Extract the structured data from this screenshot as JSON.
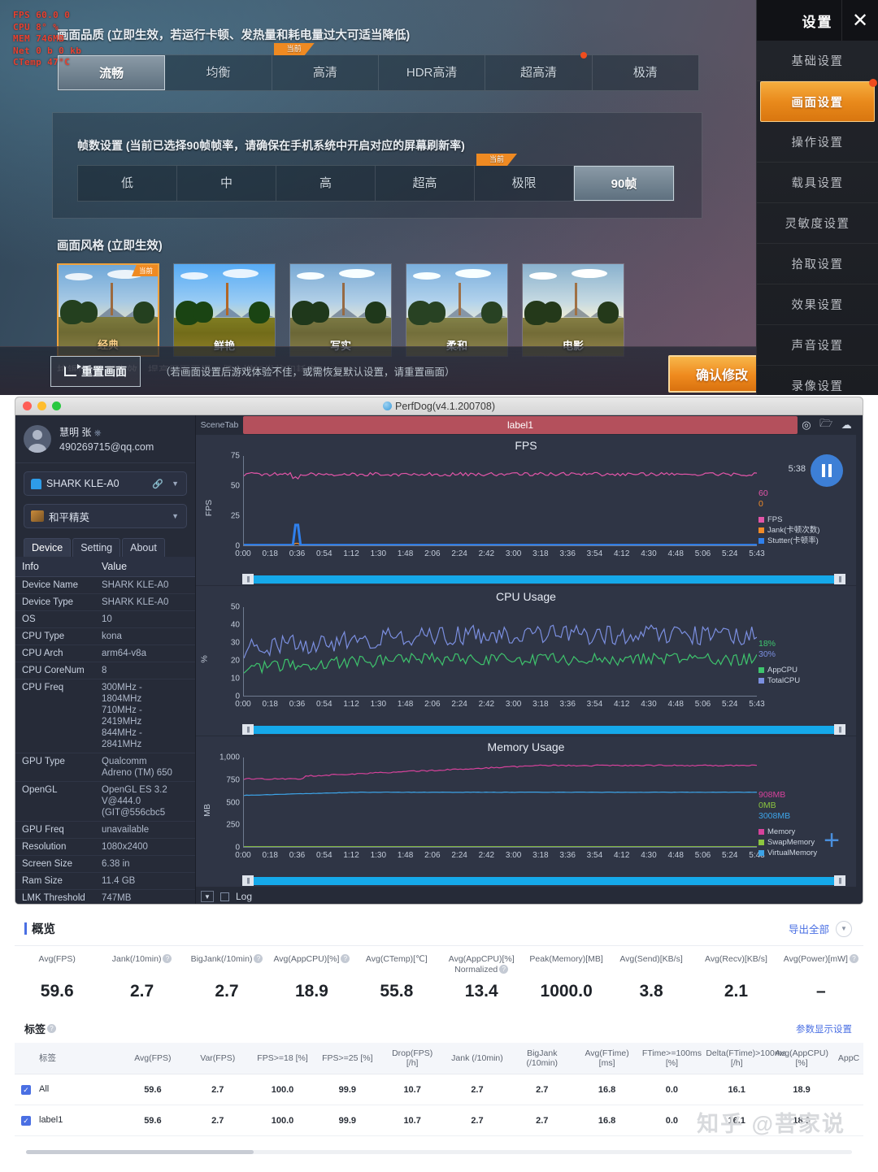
{
  "game": {
    "hud": [
      "FPS  60.0  0",
      "CPU  8°   %",
      "MEM  746MB",
      "Net  0 b   0 kb",
      "CTemp 47°C"
    ],
    "quality_title": "画面品质 (立即生效，若运行卡顿、发热量和耗电量过大可适当降低)",
    "quality_options": [
      "流畅",
      "均衡",
      "高清",
      "HDR高清",
      "超高清",
      "极清"
    ],
    "quality_selected_index": 0,
    "quality_current_index": 2,
    "fps_title": "帧数设置 (当前已选择90帧帧率，请确保在手机系统中开启对应的屏幕刷新率)",
    "fps_options": [
      "低",
      "中",
      "高",
      "超高",
      "极限",
      "90帧"
    ],
    "fps_selected_index": 5,
    "fps_current_index": 4,
    "style_title": "画面风格 (立即生效)",
    "styles": [
      "经典",
      "鲜艳",
      "写实",
      "柔和",
      "电影"
    ],
    "style_selected_index": 0,
    "current_badge": "当前",
    "cut_text": "抗锯齿 (立即生效，提高画面平滑，但会增加发热和耗电)",
    "reset_label": "重置画面",
    "footer_note": "（若画面设置后游戏体验不佳，或需恢复默认设置，请重置画面）",
    "confirm_label": "确认修改",
    "sidebar": {
      "title": "设置",
      "close_icon": "close-icon",
      "items": [
        "基础设置",
        "画面设置",
        "操作设置",
        "载具设置",
        "灵敏度设置",
        "拾取设置",
        "效果设置",
        "声音设置",
        "录像设置"
      ],
      "active_index": 1
    }
  },
  "perfdog": {
    "window_title": "PerfDog(v4.1.200708)",
    "user": {
      "name": "慧明 张",
      "power_icon": "power-icon",
      "email": "490269715@qq.com"
    },
    "device_select": {
      "value": "SHARK KLE-A0",
      "icon": "android-icon",
      "link_icon": "link-icon",
      "caret": "▼"
    },
    "app_select": {
      "value": "和平精英",
      "icon": "game-icon",
      "caret": "▼"
    },
    "tabs": [
      "Device",
      "Setting",
      "About"
    ],
    "active_tab": 0,
    "info_headers": [
      "Info",
      "Value"
    ],
    "info_rows": [
      [
        "Device Name",
        "SHARK KLE-A0"
      ],
      [
        "Device Type",
        "SHARK KLE-A0"
      ],
      [
        "OS",
        "10"
      ],
      [
        "CPU Type",
        "kona"
      ],
      [
        "CPU Arch",
        "arm64-v8a"
      ],
      [
        "CPU CoreNum",
        "8"
      ],
      [
        "CPU Freq",
        "300MHz -\n1804MHz\n710MHz -\n2419MHz\n844MHz -\n2841MHz"
      ],
      [
        "GPU Type",
        "Qualcomm\nAdreno (TM) 650"
      ],
      [
        "OpenGL",
        "OpenGL ES 3.2\nV@444.0\n(GIT@556cbc5"
      ],
      [
        "GPU Freq",
        "unavailable"
      ],
      [
        "Resolution",
        "1080x2400"
      ],
      [
        "Screen Size",
        "6.38 in"
      ],
      [
        "Ram Size",
        "11.4 GB"
      ],
      [
        "LMK Threshold",
        "747MB"
      ]
    ],
    "scene_tab_label": "SceneTab",
    "label_bar": "label1",
    "scene_icons": [
      "location-icon",
      "folder-icon",
      "cloud-icon"
    ],
    "elapsed_time": "5:38",
    "pause_icon": "pause-icon",
    "plus_icon": "plus-icon",
    "log_label": "Log",
    "log_checked": false
  },
  "chart_data": [
    {
      "type": "line",
      "title": "FPS",
      "ylabel": "FPS",
      "ylim": [
        0,
        75
      ],
      "yticks": [
        0,
        25,
        50,
        75
      ],
      "xlabel": "",
      "xticks": [
        "0:00",
        "0:18",
        "0:36",
        "0:54",
        "1:12",
        "1:30",
        "1:48",
        "2:06",
        "2:24",
        "2:42",
        "3:00",
        "3:18",
        "3:36",
        "3:54",
        "4:12",
        "4:30",
        "4:48",
        "5:06",
        "5:24",
        "5:43"
      ],
      "current_values": [
        {
          "label": "60",
          "color": "#e255a8"
        },
        {
          "label": "0",
          "color": "#f08b28"
        }
      ],
      "legend": [
        {
          "name": "FPS",
          "color": "#e255a8"
        },
        {
          "name": "Jank(卡顿次数)",
          "color": "#f08b28"
        },
        {
          "name": "Stutter(卡顿率)",
          "color": "#2f80ed"
        }
      ],
      "series": [
        {
          "name": "FPS",
          "color": "#e255a8",
          "approx_mean": 59.6,
          "min": 51,
          "max": 62
        },
        {
          "name": "Jank(卡顿次数)",
          "color": "#f08b28",
          "approx_mean": 0,
          "min": 0,
          "max": 5
        },
        {
          "name": "Stutter(卡顿率)",
          "color": "#2f80ed",
          "approx_mean": 0,
          "min": 0,
          "max": 17
        }
      ]
    },
    {
      "type": "line",
      "title": "CPU Usage",
      "ylabel": "%",
      "ylim": [
        0,
        50
      ],
      "yticks": [
        0,
        10,
        20,
        30,
        40,
        50
      ],
      "xlabel": "",
      "xticks": [
        "0:00",
        "0:18",
        "0:36",
        "0:54",
        "1:12",
        "1:30",
        "1:48",
        "2:06",
        "2:24",
        "2:42",
        "3:00",
        "3:18",
        "3:36",
        "3:54",
        "4:12",
        "4:30",
        "4:48",
        "5:06",
        "5:24",
        "5:43"
      ],
      "current_values": [
        {
          "label": "18%",
          "color": "#3ec46d"
        },
        {
          "label": "30%",
          "color": "#7b8fe0"
        }
      ],
      "legend": [
        {
          "name": "AppCPU",
          "color": "#3ec46d"
        },
        {
          "name": "TotalCPU",
          "color": "#7b8fe0"
        }
      ],
      "series": [
        {
          "name": "AppCPU",
          "color": "#3ec46d",
          "approx_mean": 18.9,
          "min": 11,
          "max": 26
        },
        {
          "name": "TotalCPU",
          "color": "#7b8fe0",
          "approx_mean": 30,
          "min": 18,
          "max": 43
        }
      ]
    },
    {
      "type": "line",
      "title": "Memory Usage",
      "ylabel": "MB",
      "ylim": [
        0,
        1000
      ],
      "yticks": [
        0,
        250,
        500,
        750,
        1000
      ],
      "xlabel": "",
      "xticks": [
        "0:00",
        "0:18",
        "0:36",
        "0:54",
        "1:12",
        "1:30",
        "1:48",
        "2:06",
        "2:24",
        "2:42",
        "3:00",
        "3:18",
        "3:36",
        "3:54",
        "4:12",
        "4:30",
        "4:48",
        "5:06",
        "5:24",
        "5:43"
      ],
      "current_values": [
        {
          "label": "908MB",
          "color": "#d6429b"
        },
        {
          "label": "0MB",
          "color": "#8cc63f"
        },
        {
          "label": "3008MB",
          "color": "#3da4e8"
        }
      ],
      "legend": [
        {
          "name": "Memory",
          "color": "#d6429b"
        },
        {
          "name": "SwapMemory",
          "color": "#8cc63f"
        },
        {
          "name": "VirtualMemory",
          "color": "#3da4e8"
        }
      ],
      "series": [
        {
          "name": "Memory",
          "color": "#d6429b",
          "approx_mean": 880,
          "min": 750,
          "max": 960
        },
        {
          "name": "SwapMemory",
          "color": "#8cc63f",
          "approx_mean": 0,
          "min": 0,
          "max": 0
        },
        {
          "name": "VirtualMemory",
          "color": "#3da4e8",
          "approx_mean": 600,
          "min": 570,
          "max": 615
        }
      ]
    }
  ],
  "report": {
    "overview_title": "概览",
    "export_label": "导出全部",
    "overview_metrics": [
      {
        "label": "Avg(FPS)",
        "help": false,
        "value": "59.6"
      },
      {
        "label": "Jank(/10min)",
        "help": true,
        "value": "2.7"
      },
      {
        "label": "BigJank(/10min)",
        "help": true,
        "value": "2.7"
      },
      {
        "label": "Avg(AppCPU)[%]",
        "help": true,
        "value": "18.9"
      },
      {
        "label": "Avg(CTemp)[℃]",
        "help": false,
        "value": "55.8"
      },
      {
        "label": "Avg(AppCPU)[%]\nNormalized",
        "help": true,
        "value": "13.4"
      },
      {
        "label": "Peak(Memory)[MB]",
        "help": false,
        "value": "1000.0"
      },
      {
        "label": "Avg(Send)[KB/s]",
        "help": false,
        "value": "3.8"
      },
      {
        "label": "Avg(Recv)[KB/s]",
        "help": false,
        "value": "2.1"
      },
      {
        "label": "Avg(Power)[mW]",
        "help": true,
        "value": "–"
      }
    ],
    "tag_title": "标签",
    "param_link": "参数显示设置",
    "tag_headers": [
      "标签",
      "Avg(FPS)",
      "Var(FPS)",
      "FPS>=18 [%]",
      "FPS>=25 [%]",
      "Drop(FPS)\n[/h]",
      "Jank (/10min)",
      "BigJank (/10min)",
      "Avg(FTime)\n[ms]",
      "FTime>=100ms [%]",
      "Delta(FTime)>100ms [/h]",
      "Avg(AppCPU)\n[%]",
      "AppC"
    ],
    "tag_rows": [
      [
        "All",
        "59.6",
        "2.7",
        "100.0",
        "99.9",
        "10.7",
        "2.7",
        "2.7",
        "16.8",
        "0.0",
        "16.1",
        "18.9",
        ""
      ],
      [
        "label1",
        "59.6",
        "2.7",
        "100.0",
        "99.9",
        "10.7",
        "2.7",
        "2.7",
        "16.8",
        "0.0",
        "16.1",
        "18.9",
        ""
      ]
    ],
    "watermark": "知乎 @菩家说"
  }
}
